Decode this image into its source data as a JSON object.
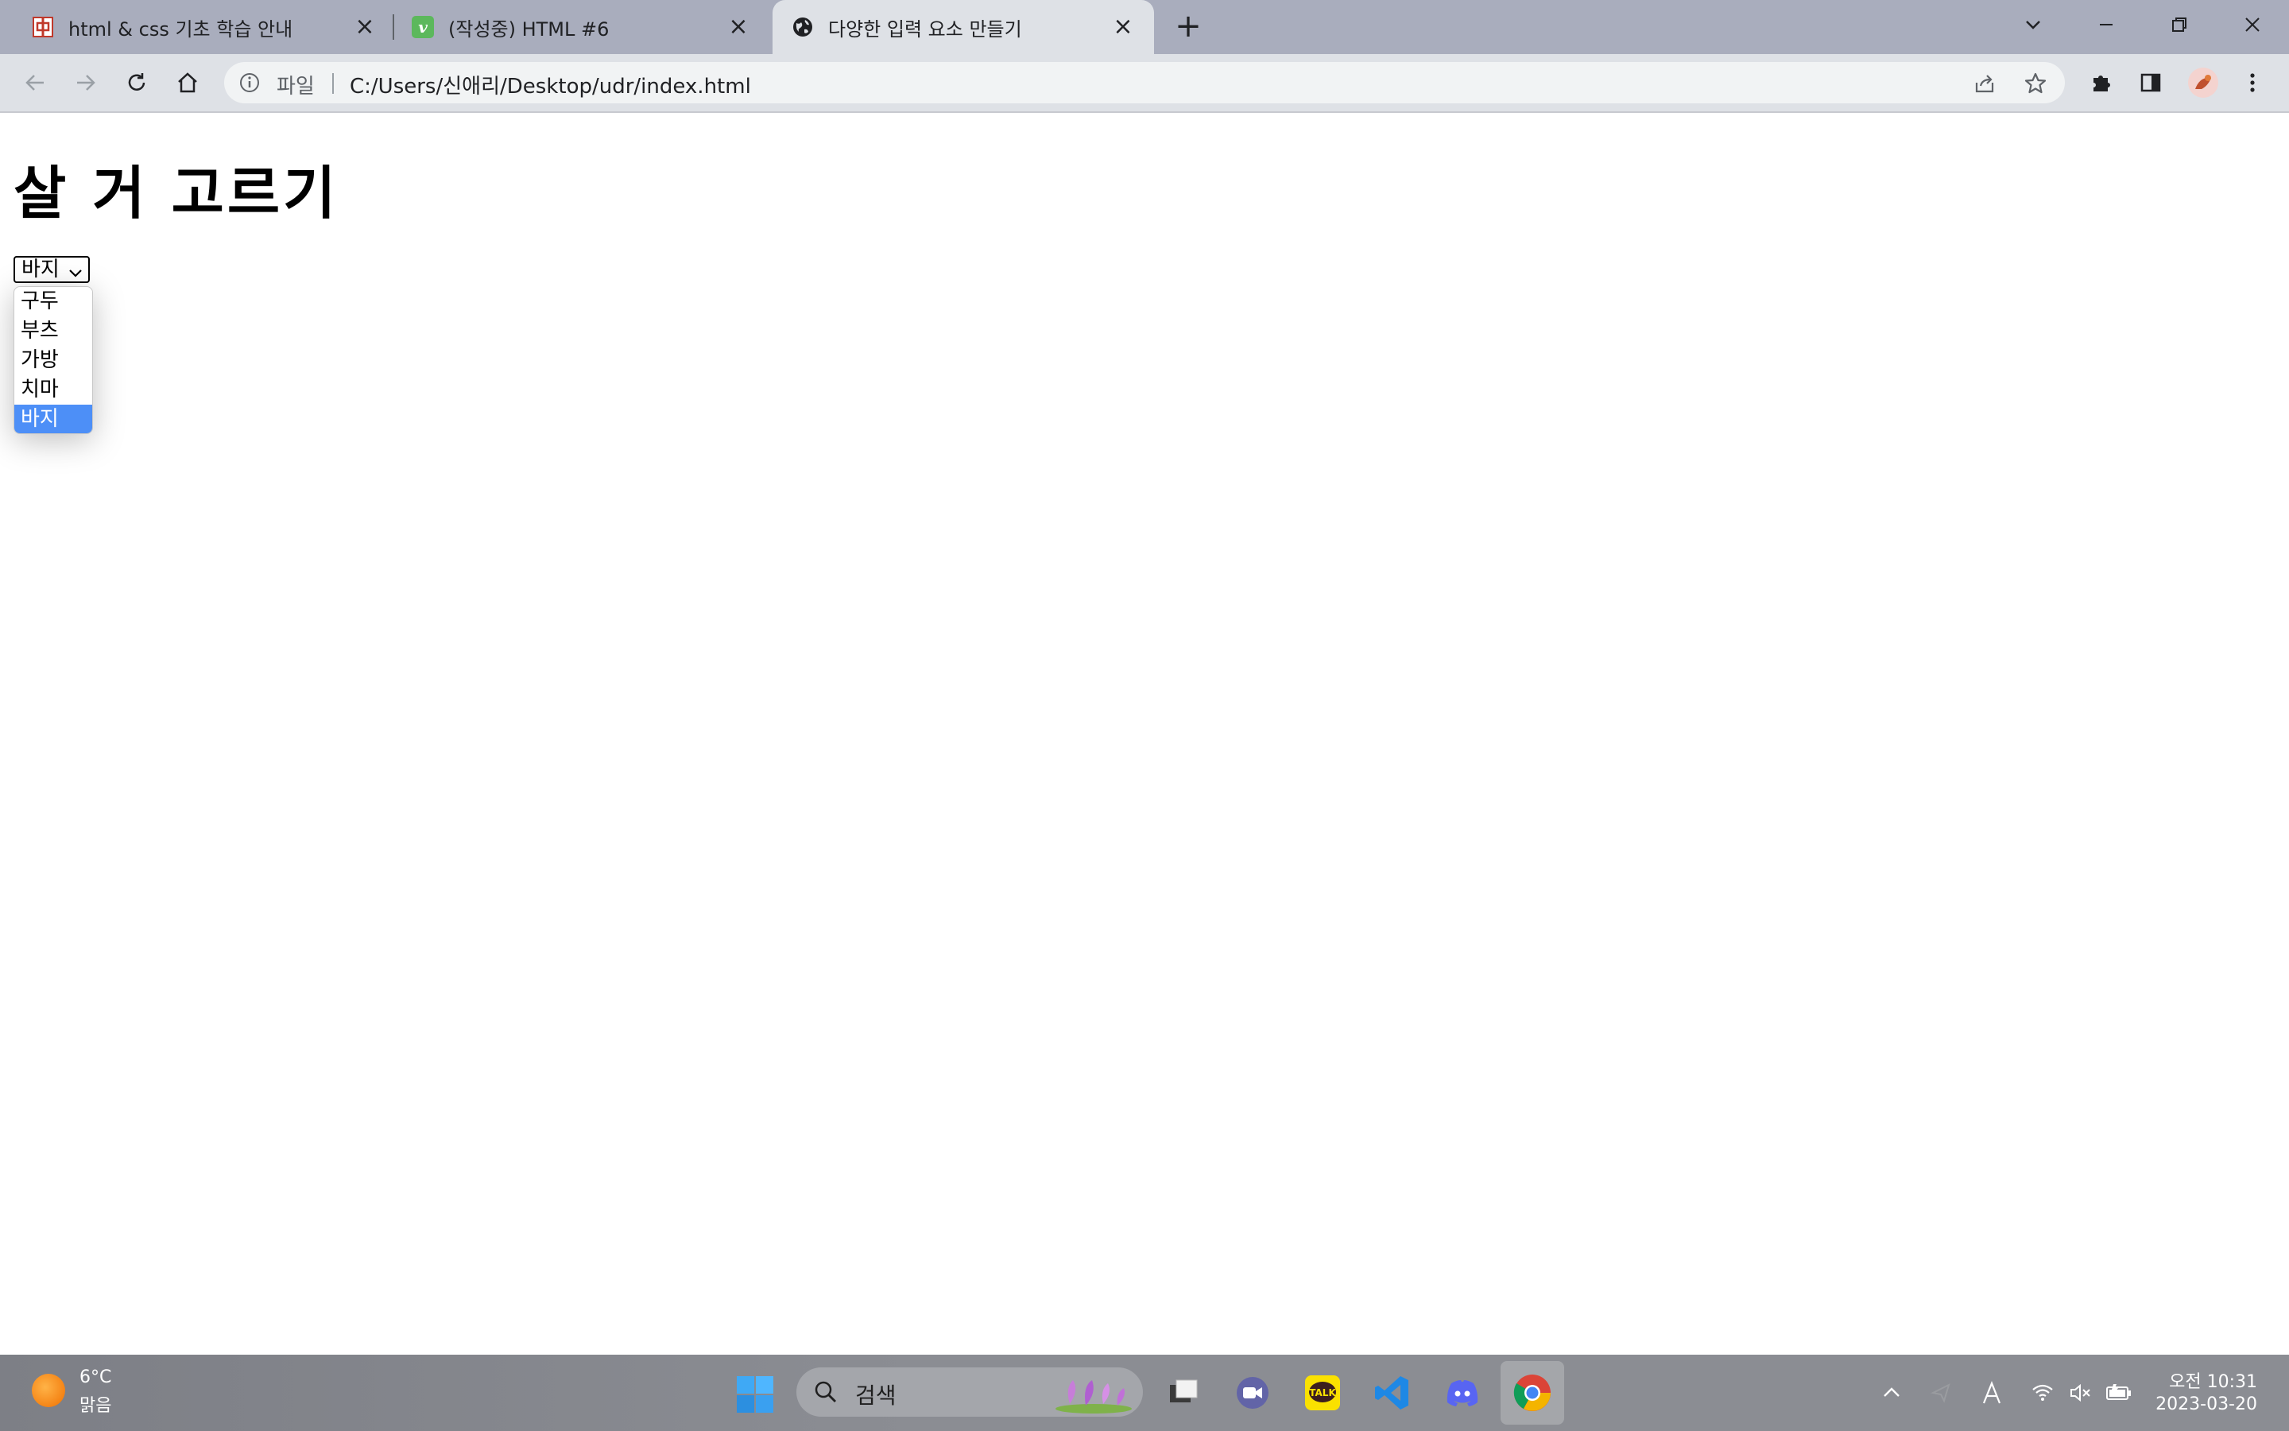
{
  "browser": {
    "tabs": [
      {
        "title": "html & css 기초 학습 안내",
        "favicon": "red-grid-icon",
        "active": false
      },
      {
        "title": "(작성중) HTML #6",
        "favicon": "v-logo-icon",
        "active": false
      },
      {
        "title": "다양한 입력 요소 만들기",
        "favicon": "globe-icon",
        "active": true
      }
    ],
    "address": {
      "scheme": "파일",
      "url": "C:/Users/신애리/Desktop/udr/index.html"
    }
  },
  "page": {
    "title": "살 거 고르기",
    "select": {
      "value": "바지",
      "options": [
        "구두",
        "부츠",
        "가방",
        "치마",
        "바지"
      ],
      "selected_index": 4
    }
  },
  "taskbar": {
    "weather": {
      "temp": "6°C",
      "desc": "맑음"
    },
    "search_placeholder": "검색",
    "clock": {
      "time": "오전 10:31",
      "date": "2023-03-20"
    }
  },
  "colors": {
    "tabbar": "#a9adbd",
    "toolbar": "#dee1e6",
    "option_selected": "#4d8ff7",
    "taskbar": "#8b8d93"
  }
}
